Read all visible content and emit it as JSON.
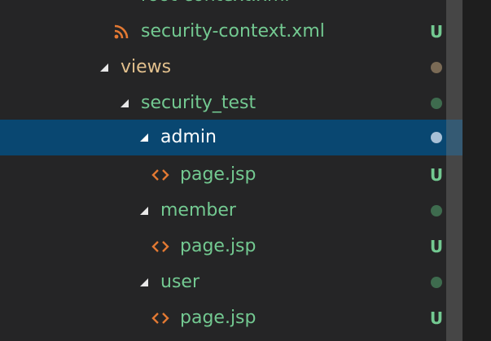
{
  "colors": {
    "untracked_text": "#73c991",
    "modified_folder_text": "#e2c08d",
    "selected_text": "#ffffff",
    "selected_bg": "#094771",
    "rss_icon": "#e37933",
    "code_icon": "#e37933",
    "dot_green": "#3e6b4e",
    "dot_brown": "#7a6a55",
    "dot_selected": "#a8c0d6"
  },
  "explorer": {
    "rows": [
      {
        "label": "root-context.xml",
        "icon": "rss-icon",
        "badge": ""
      },
      {
        "label": "security-context.xml",
        "icon": "rss-icon",
        "badge": "U"
      },
      {
        "label": "views",
        "icon": "chevron-expanded-icon",
        "badge": "dot"
      },
      {
        "label": "security_test",
        "icon": "chevron-expanded-icon",
        "badge": "dot"
      },
      {
        "label": "admin",
        "icon": "chevron-expanded-icon",
        "badge": "dot"
      },
      {
        "label": "page.jsp",
        "icon": "code-icon",
        "badge": "U"
      },
      {
        "label": "member",
        "icon": "chevron-expanded-icon",
        "badge": "dot"
      },
      {
        "label": "page.jsp",
        "icon": "code-icon",
        "badge": "U"
      },
      {
        "label": "user",
        "icon": "chevron-expanded-icon",
        "badge": "dot"
      },
      {
        "label": "page.jsp",
        "icon": "code-icon",
        "badge": "U"
      }
    ]
  }
}
